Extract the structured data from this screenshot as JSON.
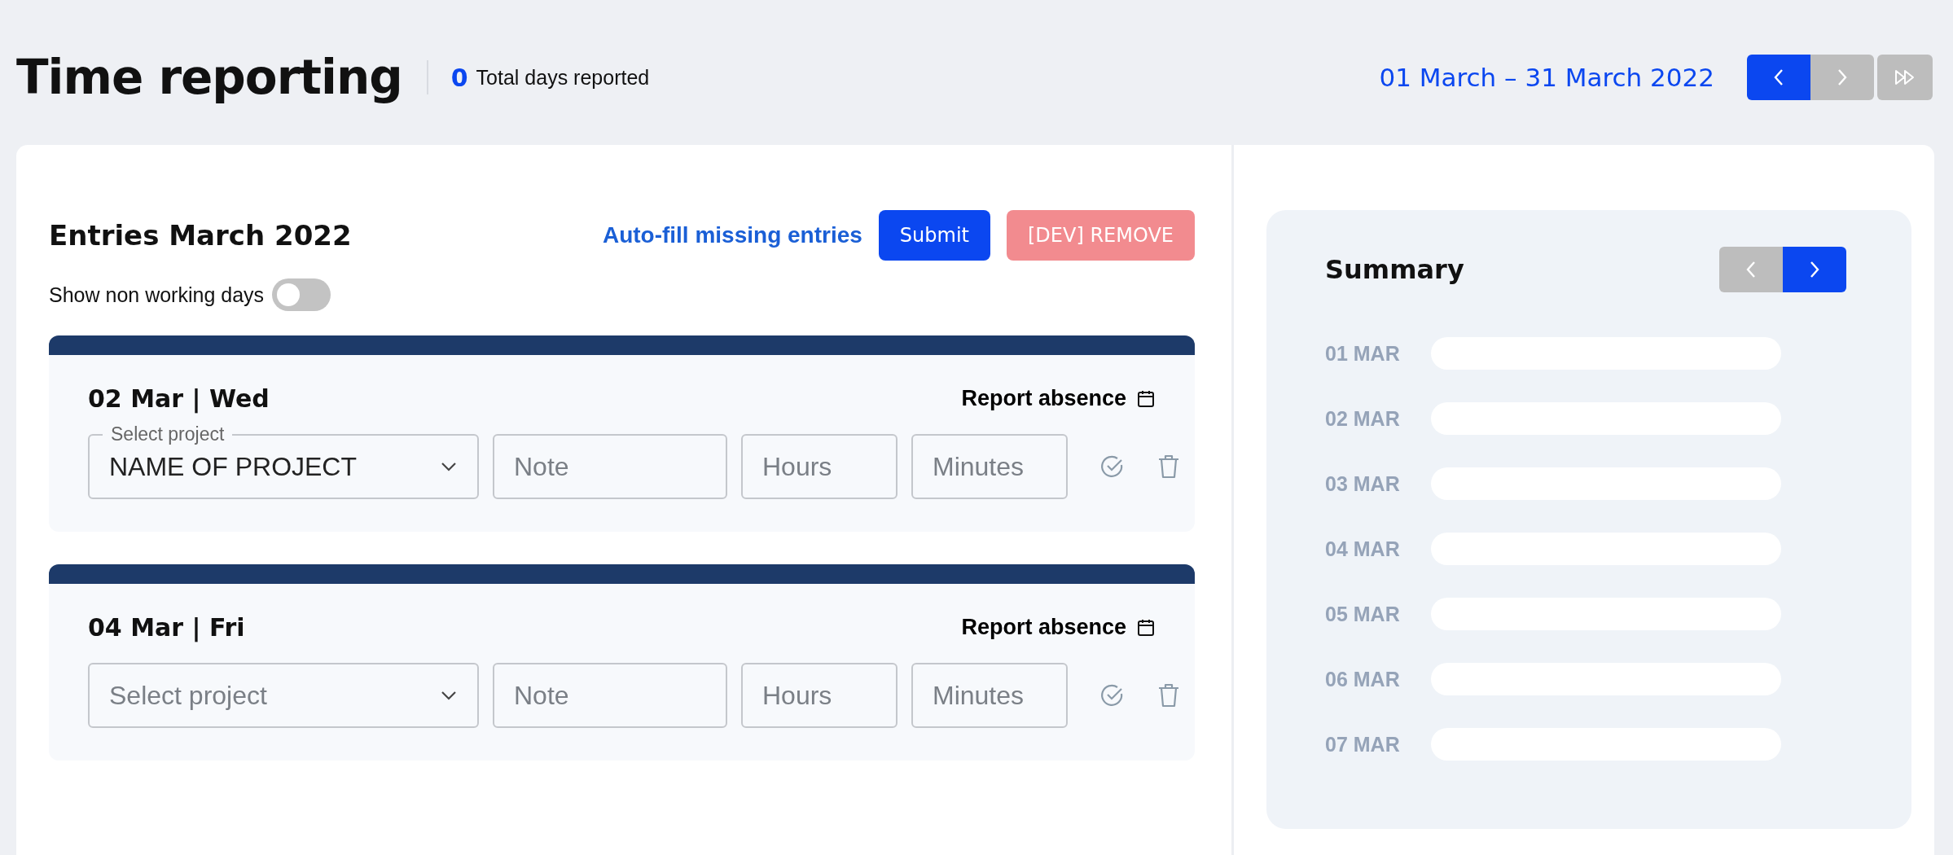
{
  "header": {
    "title": "Time reporting",
    "total_days": "0",
    "total_label": "Total days reported",
    "period": "01 March – 31 March 2022",
    "nav": [
      {
        "kind": "prev",
        "enabled": true
      },
      {
        "kind": "next",
        "enabled": false
      }
    ],
    "fast_forward": {
      "enabled": false
    }
  },
  "entries": {
    "title": "Entries March 2022",
    "autofill": "Auto-fill missing entries",
    "submit": "Submit",
    "remove": "[DEV] REMOVE",
    "toggle": {
      "label": "Show non working days",
      "on": false
    },
    "days": [
      {
        "date": "02 Mar | Wed",
        "report_absence": "Report absence",
        "project": {
          "label": "Select project",
          "value": "NAME OF PROJECT"
        },
        "note": {
          "placeholder": "Note"
        },
        "hours": {
          "placeholder": "Hours"
        },
        "minutes": {
          "placeholder": "Minutes"
        }
      },
      {
        "date": "04 Mar | Fri",
        "report_absence": "Report absence",
        "project": {
          "placeholder": "Select project"
        },
        "note": {
          "placeholder": "Note"
        },
        "hours": {
          "placeholder": "Hours"
        },
        "minutes": {
          "placeholder": "Minutes"
        }
      }
    ]
  },
  "summary": {
    "title": "Summary",
    "nav": [
      {
        "kind": "prev",
        "enabled": false
      },
      {
        "kind": "next",
        "enabled": true
      }
    ],
    "rows": [
      {
        "label": "01 MAR"
      },
      {
        "label": "02 MAR"
      },
      {
        "label": "03 MAR"
      },
      {
        "label": "04 MAR"
      },
      {
        "label": "05 MAR"
      },
      {
        "label": "06 MAR"
      },
      {
        "label": "07 MAR"
      }
    ]
  }
}
